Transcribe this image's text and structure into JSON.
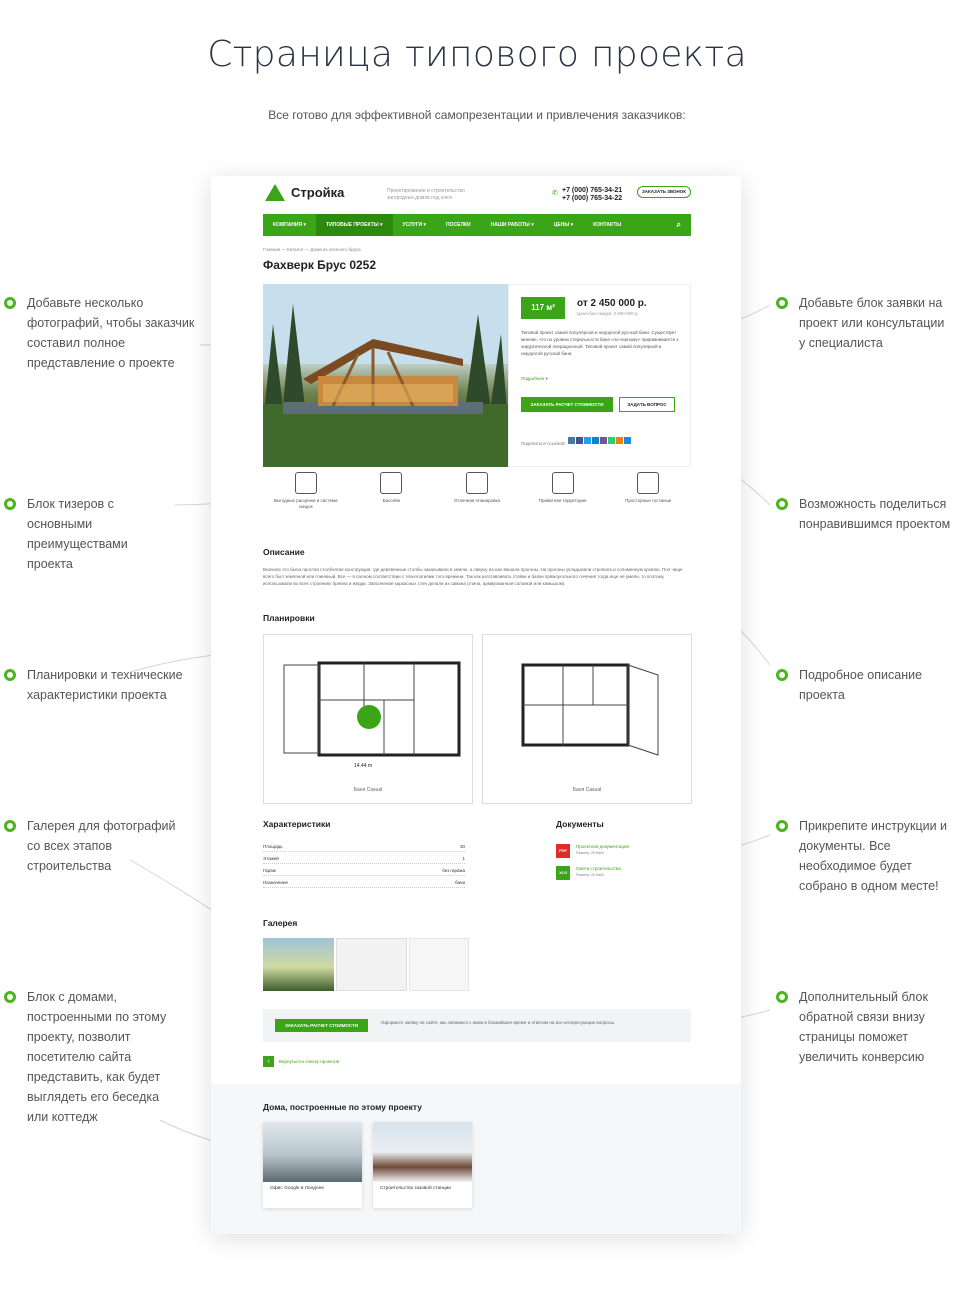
{
  "heading": {
    "title": "Страница типового проекта",
    "subtitle": "Все готово для эффективной самопрезентации и привлечения заказчиков:"
  },
  "notes": {
    "left": [
      "Добавьте несколько фотографий, чтобы заказчик составил полное представление о проекте",
      "Блок тизеров с основными преимуществами проекта",
      "Планировки и технические характеристики проекта",
      "Галерея для фотографий со всех этапов строительства",
      "Блок с домами, построенными по этому проекту, позволит посетителю сайта представить, как будет выглядеть его беседка или коттедж"
    ],
    "right": [
      "Добавьте блок заявки на проект или консультации у специалиста",
      "Возможность поделиться понравившимся проектом",
      "Подробное описание проекта",
      "Прикрепите инструкции и документы. Все необходимое будет собрано в одном месте!",
      "Дополнительный блок обратной связи внизу страницы поможет увеличить конверсию"
    ]
  },
  "site": {
    "logo": "Стройка",
    "tagline": "Проектирование и строительство загородных домов под ключ",
    "phone1": "+7 (000) 765-34-21",
    "phone2": "+7 (000) 765-34-22",
    "call_btn": "ЗАКАЗАТЬ ЗВОНОК",
    "nav": [
      "КОМПАНИЯ ▾",
      "ТИПОВЫЕ ПРОЕКТЫ ▾",
      "УСЛУГИ ▾",
      "ПОСЕЛКИ",
      "НАШИ РАБОТЫ ▾",
      "ЦЕНЫ ▾",
      "КОНТАКТЫ"
    ],
    "breadcrumbs": "Главная  —  Каталог  —  Дома из клееного бруса",
    "title": "Фахверк Брус 0252",
    "area": "117 м²",
    "price": "от  2 450 000 р.",
    "price_old": "Цена без скидки:  2 600 000 р.",
    "desc": "Типовой проект самой популярной и недорогой русской бани. Существует мнение, что по уровню стерильности баня «по-черному» приравнивается к хирургической операционной. Типовой проект самой популярной и недорогой русской бани.",
    "more": "Подробнее  ▾",
    "order_btn": "ЗАКАЗАТЬ РАСЧЕТ СТОИМОСТИ",
    "ask_btn": "ЗАДАТЬ ВОПРОС",
    "share": "Поделиться ссылкой:",
    "features": [
      "Выгодные расценки и система скидок",
      "Бассейн",
      "Отличная планировка",
      "Приватная территория",
      "Просторные гостиные"
    ],
    "description_title": "Описание",
    "description": "Вначале это была простая столбчатая конструкция, где деревянные столбы закапывали в землю, а сверху на них вешали прогоны. На прогоны укладывали стропила и соломенную кровлю. Пол чаще всего был земляной или глиняный. Все — в полном соответствии с технологиями того времени. Так как изготавливать стойки и балки прямоугольного сечения тогда еще не умели, то поэтому использовали во всех строениях бревна и жерди. Заполнение каркасных стен делали из самана (глина, армированная соломой или камышом).",
    "plans_title": "Планировки",
    "plans": [
      "Баня Casual",
      "Баня Casual"
    ],
    "chars_title": "Характеристики",
    "chars": [
      {
        "k": "Площадь",
        "v": "30"
      },
      {
        "k": "Этажей",
        "v": "1"
      },
      {
        "k": "Гараж",
        "v": "без гаража"
      },
      {
        "k": "Назначение",
        "v": "бани"
      }
    ],
    "docs_title": "Документы",
    "docs": [
      {
        "type": "PDF",
        "name": "Проектная документация",
        "size": "Размер: 29 байт"
      },
      {
        "type": "XLS",
        "name": "Смета строительства",
        "size": "Размер: 29 байт"
      }
    ],
    "gallery_title": "Галерея",
    "cta_btn": "ЗАКАЗАТЬ РАСЧЕТ СТОИМОСТИ",
    "cta_text": "Оформите заявку на сайте, мы свяжемся с вами в ближайшее время и ответим на все интересующие вопросы.",
    "back": "Вернуться к списку проектов",
    "houses_title": "Дома, построенные по этому проекту",
    "houses": [
      "Офис Google в Лондоне",
      "Строительство газовой станции"
    ]
  },
  "colors": {
    "accent": "#3aa516",
    "dark_text": "#2a3444"
  }
}
